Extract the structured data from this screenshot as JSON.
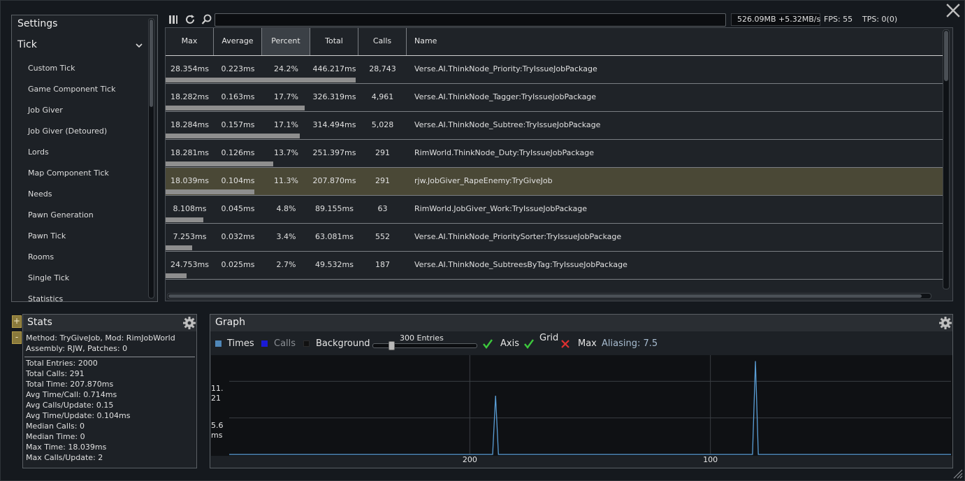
{
  "window": {
    "close_icon": "close-icon"
  },
  "sidebar": {
    "title": "Settings",
    "category": "Tick",
    "items": [
      "Custom Tick",
      "Game Component Tick",
      "Job Giver",
      "Job Giver (Detoured)",
      "Lords",
      "Map Component Tick",
      "Needs",
      "Pawn Generation",
      "Pawn Tick",
      "Rooms",
      "Single Tick",
      "Statistics"
    ]
  },
  "toolbar": {
    "search_value": "",
    "memory": "526.09MB +5.32MB/s",
    "fps": "FPS: 55",
    "tps": "TPS: 0(0)"
  },
  "table": {
    "columns": [
      "Max",
      "Average",
      "Percent",
      "Total",
      "Calls",
      "Name"
    ],
    "active_column": "Percent",
    "rows": [
      {
        "max": "28.354ms",
        "avg": "0.223ms",
        "pct": "24.2%",
        "total": "446.217ms",
        "calls": "28,743",
        "name": "Verse.AI.ThinkNode_Priority:TryIssueJobPackage",
        "percent": 24.2,
        "selected": false
      },
      {
        "max": "18.282ms",
        "avg": "0.163ms",
        "pct": "17.7%",
        "total": "326.319ms",
        "calls": "4,961",
        "name": "Verse.AI.ThinkNode_Tagger:TryIssueJobPackage",
        "percent": 17.7,
        "selected": false
      },
      {
        "max": "18.284ms",
        "avg": "0.157ms",
        "pct": "17.1%",
        "total": "314.494ms",
        "calls": "5,028",
        "name": "Verse.AI.ThinkNode_Subtree:TryIssueJobPackage",
        "percent": 17.1,
        "selected": false
      },
      {
        "max": "18.281ms",
        "avg": "0.126ms",
        "pct": "13.7%",
        "total": "251.397ms",
        "calls": "291",
        "name": "RimWorld.ThinkNode_Duty:TryIssueJobPackage",
        "percent": 13.7,
        "selected": false
      },
      {
        "max": "18.039ms",
        "avg": "0.104ms",
        "pct": "11.3%",
        "total": "207.870ms",
        "calls": "291",
        "name": "rjw.JobGiver_RapeEnemy:TryGiveJob",
        "percent": 11.3,
        "selected": true
      },
      {
        "max": "8.108ms",
        "avg": "0.045ms",
        "pct": "4.8%",
        "total": "89.155ms",
        "calls": "63",
        "name": "RimWorld.JobGiver_Work:TryIssueJobPackage",
        "percent": 4.8,
        "selected": false
      },
      {
        "max": "7.253ms",
        "avg": "0.032ms",
        "pct": "3.4%",
        "total": "63.081ms",
        "calls": "552",
        "name": "Verse.AI.ThinkNode_PrioritySorter:TryIssueJobPackage",
        "percent": 3.4,
        "selected": false
      },
      {
        "max": "24.753ms",
        "avg": "0.025ms",
        "pct": "2.7%",
        "total": "49.532ms",
        "calls": "187",
        "name": "Verse.AI.ThinkNode_SubtreesByTag:TryIssueJobPackage",
        "percent": 2.7,
        "selected": false
      }
    ]
  },
  "stats": {
    "title": "Stats",
    "plus": "+",
    "minus": "-",
    "method_line1": "Method: TryGiveJob, Mod: RimJobWorld",
    "method_line2": "Assembly: RJW, Patches: 0",
    "lines": [
      "Total Entries: 2000",
      "Total Calls: 291",
      "Total Time: 207.870ms",
      "Avg Time/Call: 0.714ms",
      "Avg Calls/Update: 0.15",
      "Avg Time/Update: 0.104ms",
      "Median Calls: 0",
      "Median Time: 0",
      "Max Time: 18.039ms",
      "Max Calls/Update: 2"
    ]
  },
  "graph": {
    "title": "Graph",
    "legend": {
      "times": "Times",
      "calls": "Calls",
      "background": "Background",
      "axis": "Axis",
      "grid": "Grid",
      "max": "Max"
    },
    "colors": {
      "times": "#4f87b8",
      "calls": "#1a1ad6",
      "background": "#111111",
      "check": "#3cc83c",
      "cross": "#e03030",
      "line": "#5a9ed6"
    },
    "entries_label": "300 Entries",
    "entries_value": 300,
    "aliasing": "Aliasing: 7.5",
    "axis_checked": true,
    "grid_checked": true,
    "max_checked": false
  },
  "chart_data": {
    "type": "line",
    "title": "",
    "xlabel": "",
    "ylabel": "",
    "y_tick_labels": [
      "11.21",
      "5.6 ms"
    ],
    "y_ticks": [
      11.21,
      5.6
    ],
    "x_tick_labels": [
      "200",
      "100"
    ],
    "x_ticks": [
      200,
      100
    ],
    "xlim": [
      300,
      0
    ],
    "ylim": [
      0,
      15
    ],
    "grid": true,
    "series": [
      {
        "name": "Times",
        "color": "#5a9ed6",
        "points": [
          [
            300,
            0
          ],
          [
            190.5,
            0
          ],
          [
            189.3,
            9.0
          ],
          [
            188.1,
            0
          ],
          [
            82.5,
            0
          ],
          [
            81.3,
            14.3
          ],
          [
            80.1,
            0
          ],
          [
            0,
            0
          ]
        ]
      }
    ]
  }
}
